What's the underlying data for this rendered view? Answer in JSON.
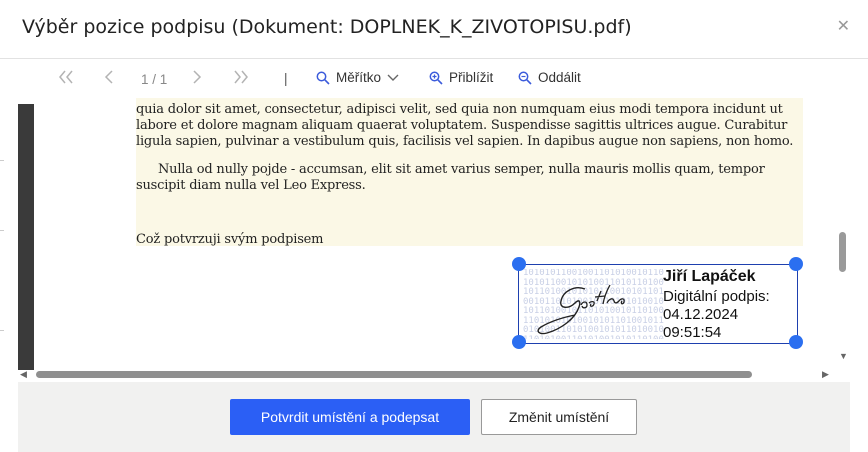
{
  "dialog": {
    "title": "Výběr pozice podpisu (Dokument: DOPLNEK_K_ZIVOTOPISU.pdf)",
    "close_icon": "close-icon"
  },
  "toolbar": {
    "first_icon": "double-chevron-left-icon",
    "prev_icon": "chevron-left-icon",
    "page_indicator": "1 / 1",
    "next_icon": "chevron-right-icon",
    "last_icon": "double-chevron-right-icon",
    "separator": "|",
    "scale_label": "Měřítko",
    "zoom_in_label": "Přiblížit",
    "zoom_out_label": "Oddálit"
  },
  "document": {
    "para1": "quia dolor sit amet, consectetur, adipisci velit, sed quia non numquam eius modi tempora incidunt ut labore et dolore magnam aliquam quaerat voluptatem. Suspendisse sagittis ultrices augue. Curabitur ligula sapien, pulvinar a vestibulum quis, facilisis vel sapien. In dapibus augue non sapiens, non homo.",
    "para2": "Nulla od nully pojde - accumsan, elit sit amet varius semper, nulla mauris mollis quam, tempor suscipit diam nulla vel Leo Express.",
    "confirm_line": "Což potvrzuji svým podpisem"
  },
  "signature": {
    "name": "Jiří Lapáček",
    "label": "Digitální podpis:",
    "date": "04.12.2024",
    "time": "09:51:54",
    "handwritten": "Goethe"
  },
  "footer": {
    "confirm_button": "Potvrdit umístění a podepsat",
    "change_button": "Změnit umístění"
  },
  "colors": {
    "primary": "#2b5ff5",
    "handle": "#2b6ff0",
    "page_bg": "#fbf8e6",
    "footer_bg": "#f1f1f0"
  }
}
